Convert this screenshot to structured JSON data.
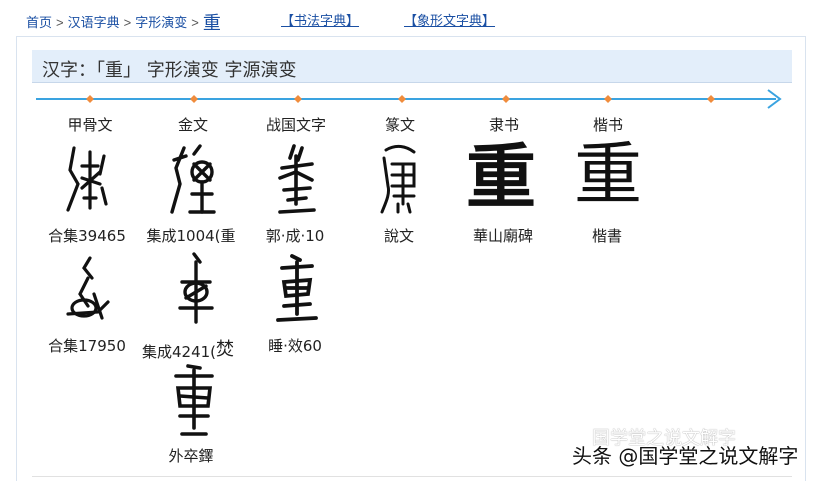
{
  "breadcrumb": {
    "home": "首页",
    "dict": "汉语字典",
    "evolution": "字形演变",
    "current": "重",
    "sep": ">"
  },
  "links": {
    "calligraphy": "【书法字典】",
    "pictograph": "【象形文字典】"
  },
  "header": {
    "title": "汉字：「重」 字形演变 字源演变"
  },
  "periods": [
    "甲骨文",
    "金文",
    "战国文字",
    "篆文",
    "隶书",
    "楷书"
  ],
  "glyphs": {
    "row1": [
      "合集39465",
      "集成1004(重",
      "郭·成·10",
      "說文",
      "華山廟碑",
      "楷書"
    ],
    "row2": [
      "合集17950",
      "集成4241(",
      "睡·效60"
    ],
    "row2_extra": "焚",
    "row3": [
      "外卒鐸"
    ]
  },
  "script_chars": {
    "clerical": "重",
    "regular": "重"
  },
  "watermark": {
    "logo_text": "国学堂之说文解字",
    "text": "头条 @国学堂之说文解字"
  },
  "colors": {
    "link": "#1a4fa3",
    "timeline": "#3aa3e0",
    "timeline_dot": "#f08c3c",
    "header_bg": "#e3eefa"
  }
}
